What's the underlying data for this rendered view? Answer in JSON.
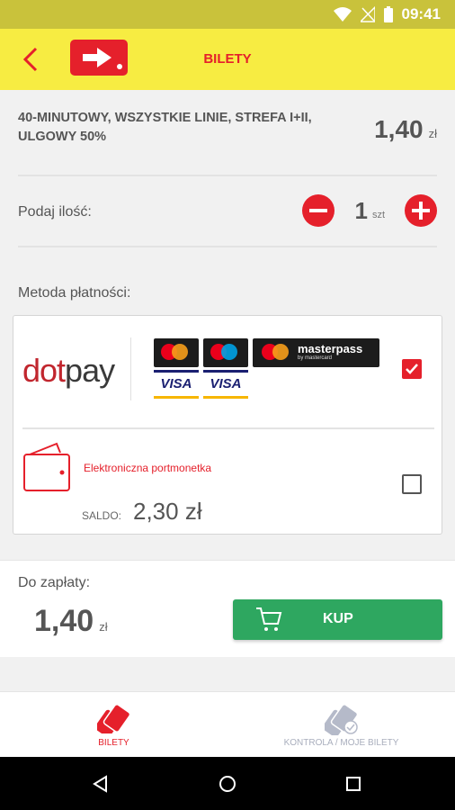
{
  "status_bar": {
    "time": "09:41",
    "icons": [
      "wifi-icon",
      "signal-off-icon",
      "battery-icon"
    ]
  },
  "app_bar": {
    "title": "BILETY",
    "back_icon": "chevron-left-icon",
    "logo_icon": "arrow-right-logo"
  },
  "product": {
    "name": "40-MINUTOWY, WSZYSTKIE LINIE, STREFA I+II, ULGOWY 50%",
    "price": "1,40",
    "currency": "zł"
  },
  "quantity": {
    "label": "Podaj ilość:",
    "value": "1",
    "unit": "szt"
  },
  "payment": {
    "label": "Metoda płatności:",
    "dotpay": {
      "brand_dot": "dot",
      "brand_pay": "pay",
      "selected": true
    },
    "cards": {
      "visa_label": "VISA",
      "masterpass_label": "masterpass",
      "masterpass_sub": "by mastercard"
    },
    "wallet": {
      "label": "Elektroniczna portmonetka",
      "saldo_label": "SALDO:",
      "saldo_value": "2,30 zł",
      "selected": false
    }
  },
  "summary": {
    "due_label": "Do zapłaty:",
    "amount": "1,40",
    "currency": "zł",
    "buy_label": "KUP"
  },
  "tabs": [
    {
      "label": "BILETY",
      "active": true
    },
    {
      "label": "KONTROLA / MOJE BILETY",
      "active": false
    }
  ],
  "colors": {
    "accent_red": "#e5202b",
    "app_bar_yellow": "#f7ec42",
    "status_bar": "#c9c23b",
    "buy_green": "#2ea760"
  }
}
